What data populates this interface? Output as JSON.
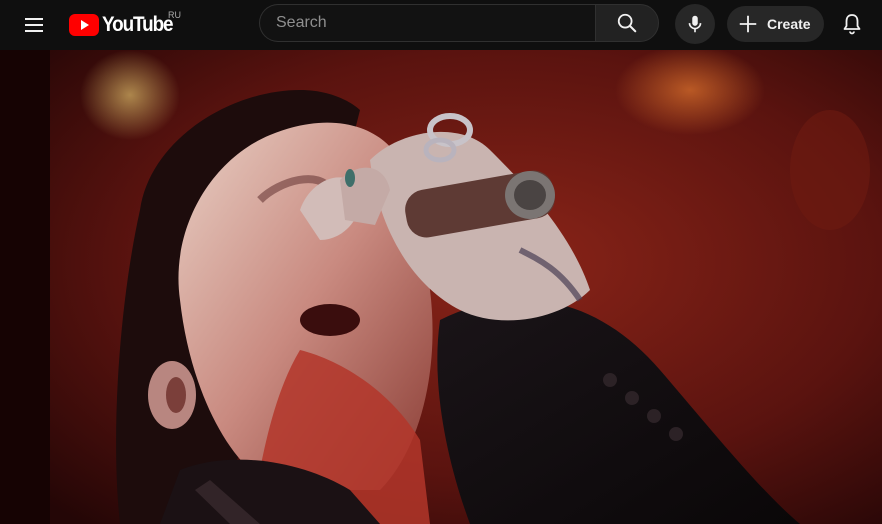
{
  "header": {
    "menu_icon": "hamburger-menu-icon",
    "logo_text": "YouTube",
    "region_code": "RU",
    "search": {
      "placeholder": "Search",
      "value": ""
    },
    "search_icon": "search-icon",
    "mic_icon": "microphone-icon",
    "create_label": "Create",
    "create_icon": "plus-icon",
    "notifications_icon": "bell-icon"
  },
  "colors": {
    "brand_red": "#ff0000",
    "background": "#0f0f0f",
    "button_bg": "#272727"
  },
  "player": {
    "frame_description_icon": "video-frame"
  }
}
